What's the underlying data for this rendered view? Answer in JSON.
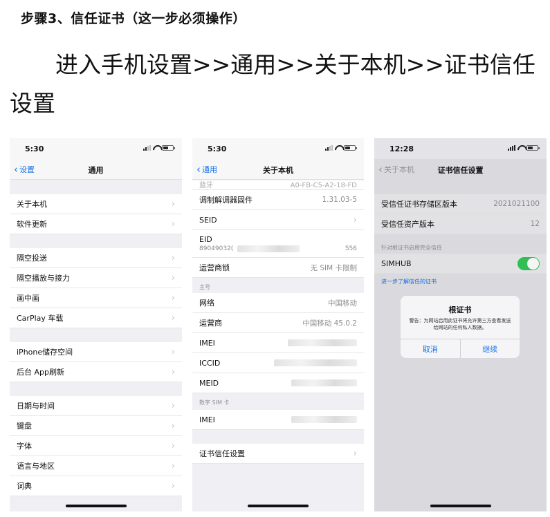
{
  "header": {
    "step_title": "步骤3、信任证书（这一步必须操作）",
    "instruction": "进入手机设置>>通用>>关于本机>>证书信任设置"
  },
  "phone1": {
    "time": "5:30",
    "back_label": "设置",
    "title": "通用",
    "groups": [
      [
        "关于本机",
        "软件更新"
      ],
      [
        "隔空投送",
        "隔空播放与接力",
        "画中画",
        "CarPlay 车载"
      ],
      [
        "iPhone储存空间",
        "后台 App刷新"
      ],
      [
        "日期与时间",
        "键盘",
        "字体",
        "语言与地区",
        "词典"
      ]
    ]
  },
  "phone2": {
    "time": "5:30",
    "back_label": "通用",
    "title": "关于本机",
    "partial_row": {
      "label": "蓝牙",
      "value": "A0-FB-C5-A2-18-FD"
    },
    "modem": {
      "label": "调制解调器固件",
      "value": "1.31.03-5"
    },
    "seid": "SEID",
    "eid": {
      "label": "EID",
      "prefix": "89049032(",
      "suffix": "556"
    },
    "carrier_lock": {
      "label": "运营商锁",
      "value": "无 SIM 卡限制"
    },
    "primary_section": "主号",
    "network": {
      "label": "网络",
      "value": "中国移动"
    },
    "carrier": {
      "label": "运营商",
      "value": "中国移动 45.0.2"
    },
    "imei": "IMEI",
    "iccid": "ICCID",
    "meid": "MEID",
    "digital_sim_section": "数字 SIM 卡",
    "imei2": "IMEI",
    "cert_trust": "证书信任设置"
  },
  "phone3": {
    "time": "12:28",
    "back_label": "关于本机",
    "title": "证书信任设置",
    "store_version": {
      "label": "受信任证书存储区版本",
      "value": "2021021100"
    },
    "asset_version": {
      "label": "受信任资产版本",
      "value": "12"
    },
    "enable_section": "针对根证书启用完全信任",
    "simhub_label": "SIMHUB",
    "toggle_on": true,
    "learn_more": "进一步了解信任的证书",
    "alert": {
      "title": "根证书",
      "message": "警告：为网站启用此证书将允许第三方查看发送给网站的任何私人数据。",
      "cancel": "取消",
      "continue": "继续"
    }
  }
}
